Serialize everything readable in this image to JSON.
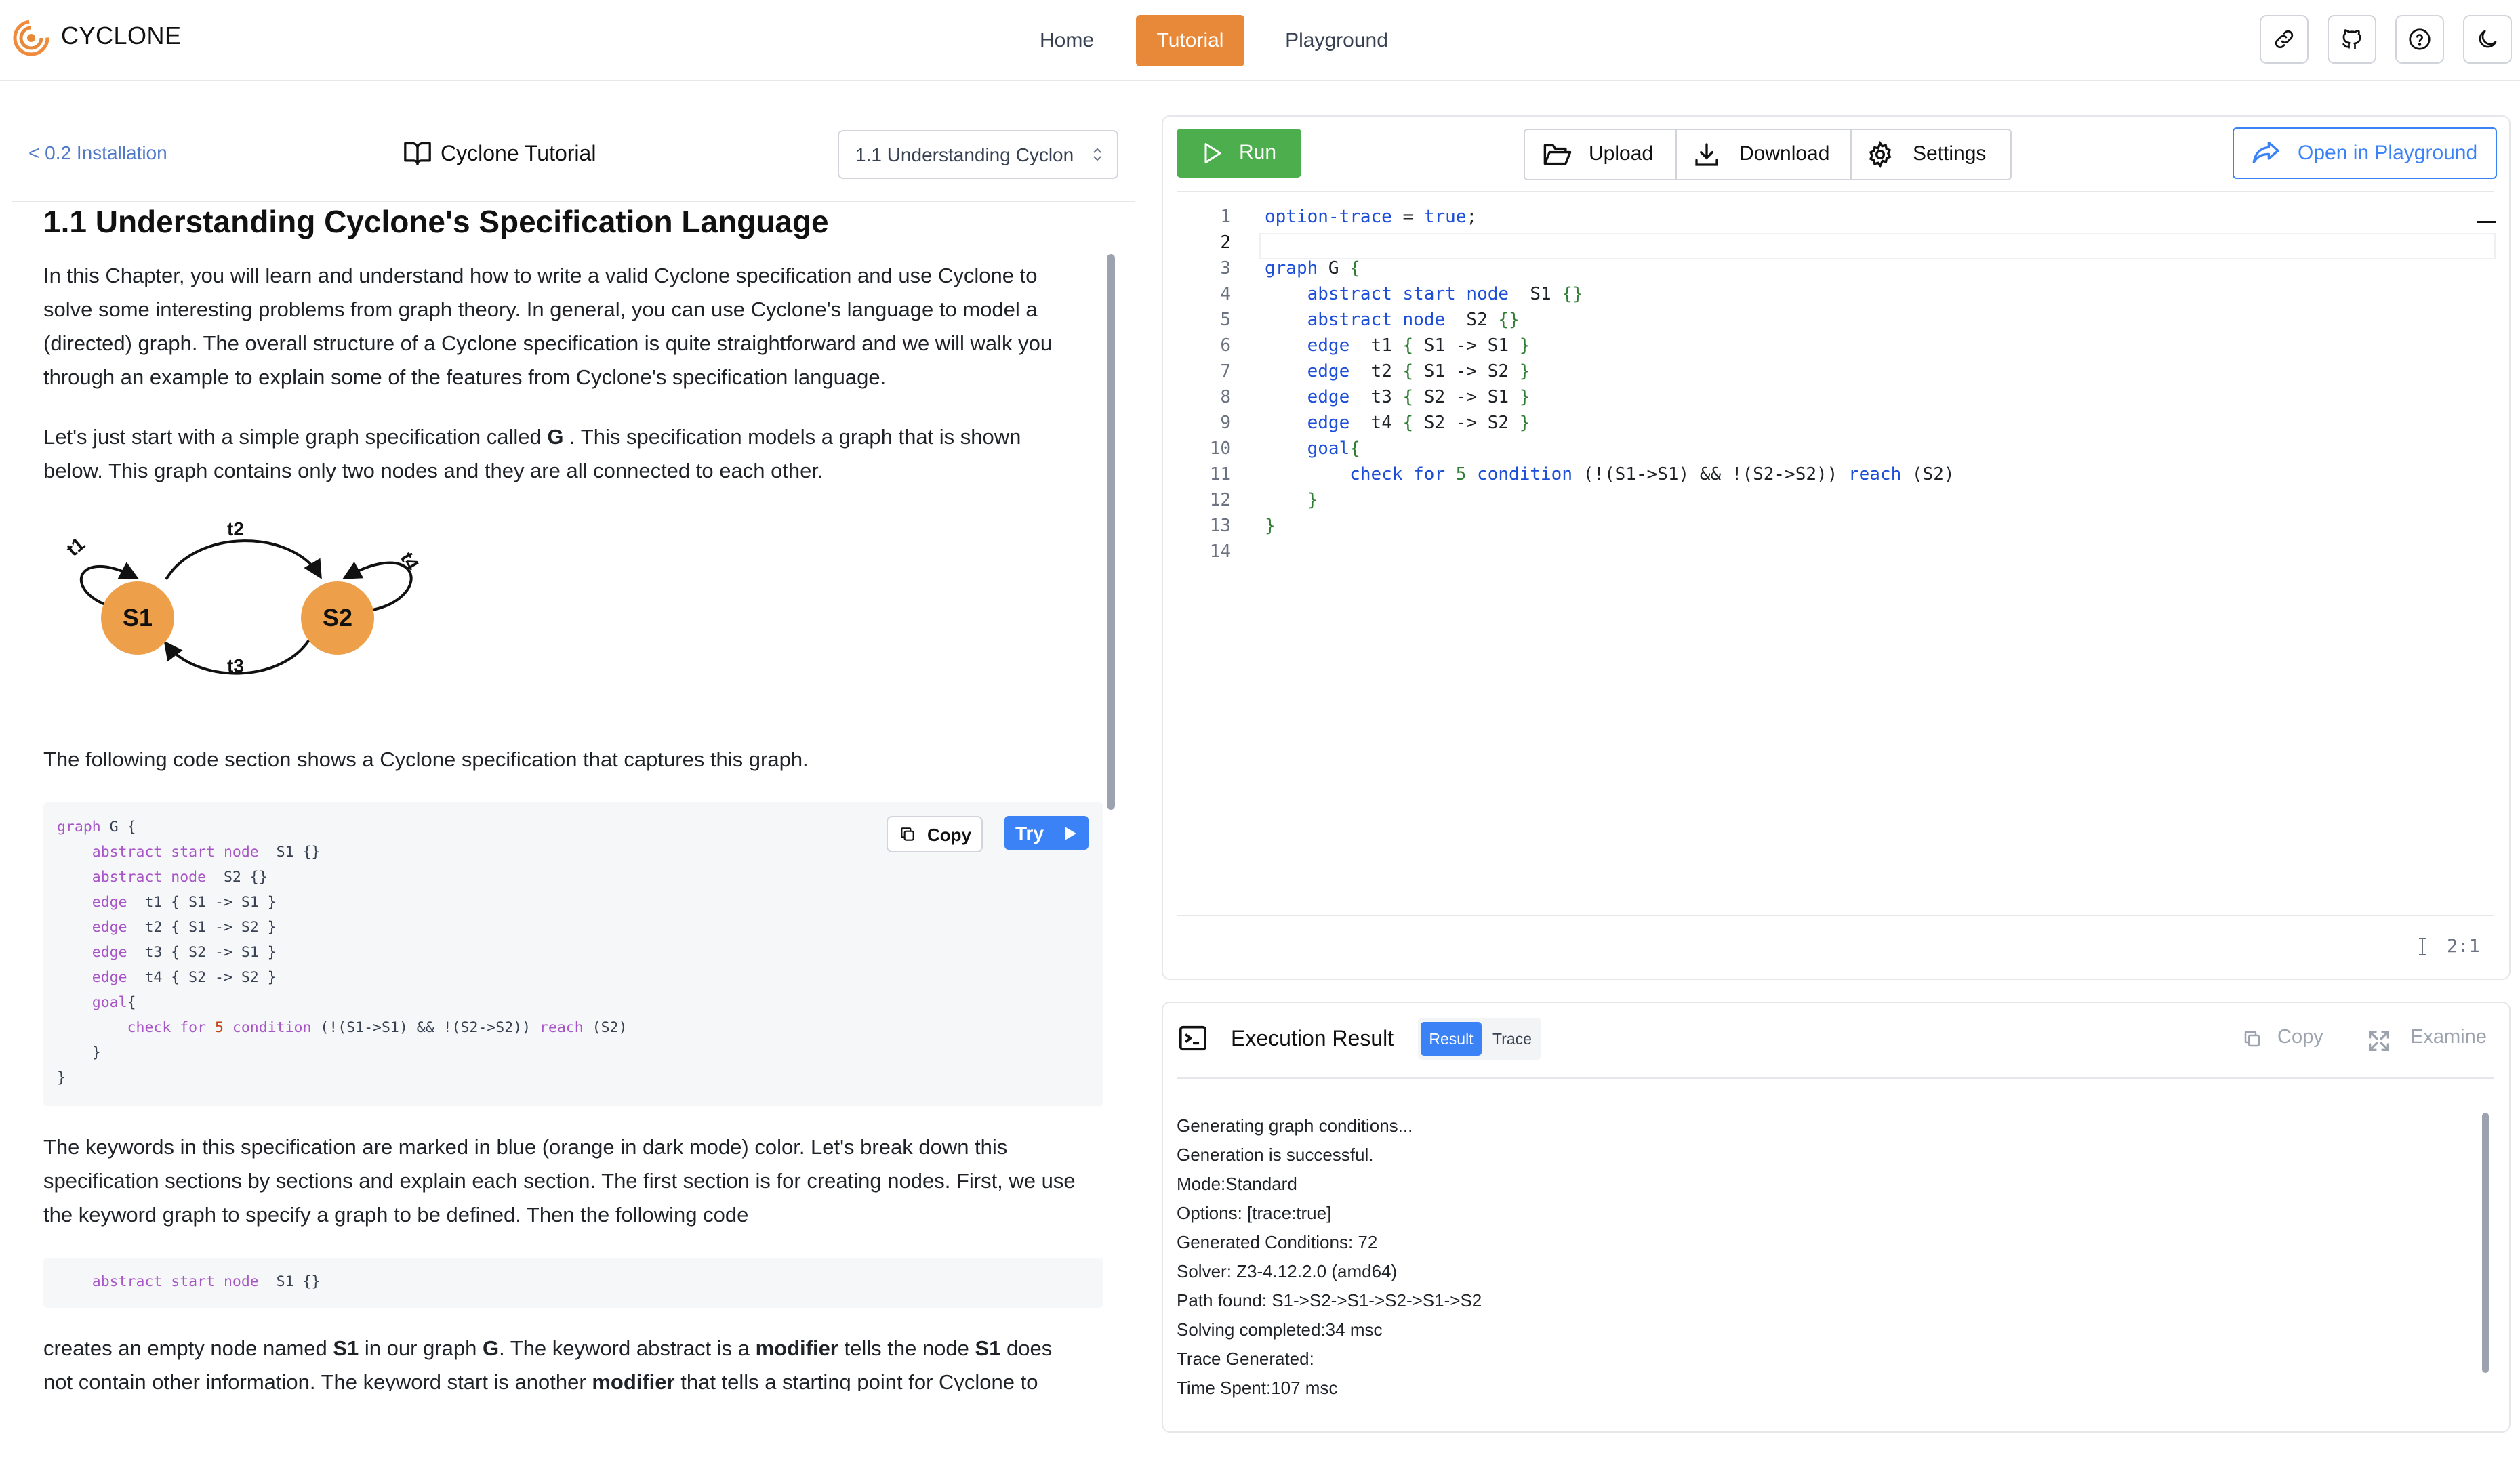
{
  "brand": {
    "name": "CYCLONE",
    "logo_icon": "swirl-logo"
  },
  "nav": {
    "items": [
      {
        "label": "Home",
        "active": false
      },
      {
        "label": "Tutorial",
        "active": true
      },
      {
        "label": "Playground",
        "active": false
      }
    ]
  },
  "header_icons": [
    "link-icon",
    "github-icon",
    "help-icon",
    "moon-icon"
  ],
  "colors": {
    "accent": "#e8893a",
    "primary": "#3b82f6",
    "run": "#4cae4c",
    "keyword": "#a855c7",
    "node": "#eda049"
  },
  "tutorial": {
    "back_link": "< 0.2 Installation",
    "title": "Cyclone Tutorial",
    "chapter_select": "1.1 Understanding Cyclon",
    "heading": "1.1 Understanding Cyclone's Specification Language",
    "para1": [
      "In this Chapter, you will learn and understand how to write a valid Cyclone specification and use Cyclone to",
      "solve some interesting problems from graph theory. In general, you can use Cyclone's language to model a",
      "(directed) graph. The overall structure of a Cyclone specification is quite straightforward and we will walk you",
      "through an example to explain some of the features from Cyclone's specification language."
    ],
    "para2_a": "Let's just start with a simple graph specification called ",
    "para2_bold": "G",
    "para2_b": " . This specification models a graph that is shown",
    "para2_line2": "below. This graph contains only two nodes and they are all connected to each other.",
    "graph": {
      "nodes": [
        "S1",
        "S2"
      ],
      "edges": [
        "t1",
        "t2",
        "t3",
        "t4"
      ]
    },
    "para3": "The following code section shows a Cyclone specification that captures this graph.",
    "code_copy": "Copy",
    "code_try": "Try",
    "para4": [
      "The keywords in this specification are marked in blue (orange in dark mode) color. Let's break down this",
      "specification sections by sections and explain each section. The first section is for creating nodes. First, we use",
      "the keyword graph to specify a graph to be defined. Then the following code"
    ],
    "para5": {
      "l1_a": "creates an empty node named ",
      "l1_b": "S1",
      "l1_c": " in our graph ",
      "l1_d": "G",
      "l1_e": ". The keyword abstract is a ",
      "l1_f": "modifier",
      "l1_g": " tells the node ",
      "l1_h": "S1",
      "l1_i": " does",
      "l2_a": "not contain other information. The keyword start is another ",
      "l2_b": "modifier",
      "l2_c": " that tells a starting point for Cyclone to"
    }
  },
  "editor": {
    "run_label": "Run",
    "upload_label": "Upload",
    "download_label": "Download",
    "settings_label": "Settings",
    "open_playground_label": "Open in Playground",
    "line_numbers": [
      "1",
      "2",
      "3",
      "4",
      "5",
      "6",
      "7",
      "8",
      "9",
      "10",
      "11",
      "12",
      "13",
      "14"
    ],
    "cursor_position": "2:1"
  },
  "execution": {
    "title": "Execution Result",
    "tab_result": "Result",
    "tab_trace": "Trace",
    "copy_label": "Copy",
    "examine_label": "Examine",
    "output": [
      "Generating graph conditions...",
      "Generation is successful.",
      "Mode:Standard",
      "Options: [trace:true]",
      "Generated Conditions: 72",
      "Solver: Z3-4.12.2.0 (amd64)",
      "Path found: S1->S2->S1->S2->S1->S2",
      "Solving completed:34 msc",
      "Trace Generated:",
      "Time Spent:107 msc"
    ]
  }
}
